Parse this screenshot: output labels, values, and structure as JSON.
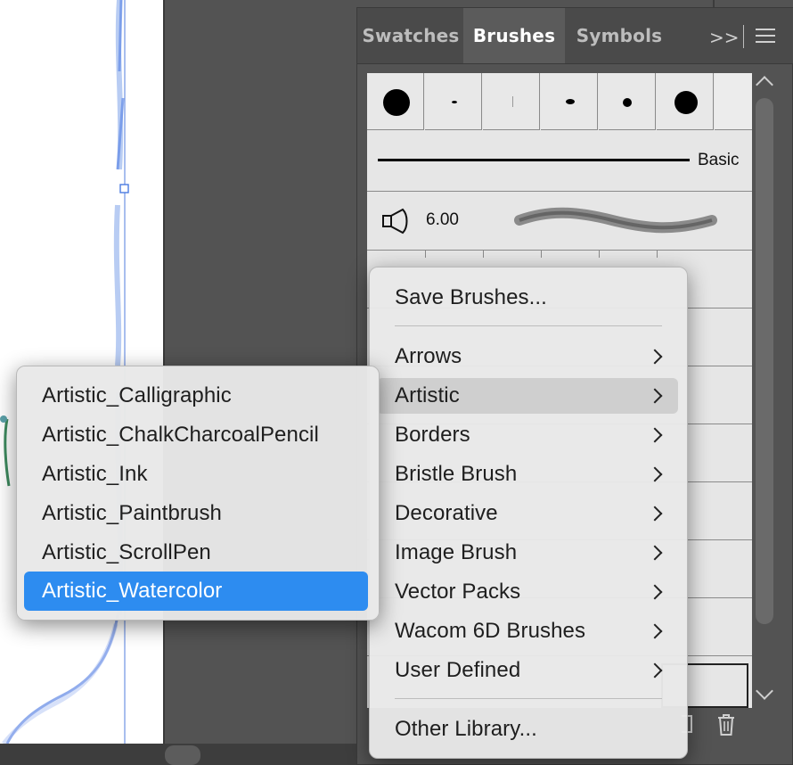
{
  "panel": {
    "tabs": [
      {
        "label": "Swatches",
        "active": false
      },
      {
        "label": "Brushes",
        "active": true
      },
      {
        "label": "Symbols",
        "active": false
      }
    ],
    "expand_label": ">>"
  },
  "brushes": {
    "basic_label": "Basic",
    "size_label": "6.00"
  },
  "main_menu": {
    "top_item": "Save Brushes...",
    "items": [
      {
        "label": "Arrows"
      },
      {
        "label": "Artistic",
        "highlighted": true
      },
      {
        "label": "Borders"
      },
      {
        "label": "Bristle Brush"
      },
      {
        "label": "Decorative"
      },
      {
        "label": "Image Brush"
      },
      {
        "label": "Vector Packs"
      },
      {
        "label": "Wacom 6D Brushes"
      },
      {
        "label": "User Defined"
      }
    ],
    "bottom_item": "Other Library..."
  },
  "sub_menu": {
    "items": [
      {
        "label": "Artistic_Calligraphic"
      },
      {
        "label": "Artistic_ChalkCharcoalPencil"
      },
      {
        "label": "Artistic_Ink"
      },
      {
        "label": "Artistic_Paintbrush"
      },
      {
        "label": "Artistic_ScrollPen"
      },
      {
        "label": "Artistic_Watercolor",
        "selected": true
      }
    ]
  },
  "colors": {
    "selection": "#2d8cf0",
    "canvas": "#535353",
    "path": "#5b86e0"
  }
}
